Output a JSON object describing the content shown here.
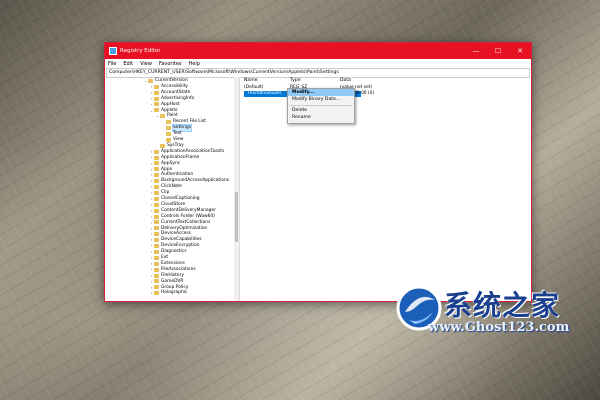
{
  "window": {
    "title": "Registry Editor",
    "controls": {
      "minimize": "—",
      "maximize": "☐",
      "close": "✕"
    }
  },
  "menu": [
    "File",
    "Edit",
    "View",
    "Favorites",
    "Help"
  ],
  "address": "Computer\\HKEY_CURRENT_USER\\Software\\Microsoft\\Windows\\CurrentVersion\\Applets\\Paint\\Settings",
  "tree": [
    {
      "label": "CurrentVersion",
      "depth": 0,
      "exp": "⌄"
    },
    {
      "label": "Accessibility",
      "depth": 1,
      "exp": "›"
    },
    {
      "label": "AccountState",
      "depth": 1,
      "exp": "›"
    },
    {
      "label": "AdvertisingInfo",
      "depth": 1,
      "exp": "›"
    },
    {
      "label": "AppHost",
      "depth": 1,
      "exp": "›"
    },
    {
      "label": "Applets",
      "depth": 1,
      "exp": "⌄"
    },
    {
      "label": "Paint",
      "depth": 2,
      "exp": "⌄"
    },
    {
      "label": "Recent File List",
      "depth": 3,
      "exp": ""
    },
    {
      "label": "Settings",
      "depth": 3,
      "exp": "",
      "selected": true
    },
    {
      "label": "Text",
      "depth": 3,
      "exp": ""
    },
    {
      "label": "View",
      "depth": 3,
      "exp": ""
    },
    {
      "label": "SysTray",
      "depth": 2,
      "exp": ""
    },
    {
      "label": "ApplicationAssociationToasts",
      "depth": 1,
      "exp": "›"
    },
    {
      "label": "ApplicationFrame",
      "depth": 1,
      "exp": "›"
    },
    {
      "label": "AppSync",
      "depth": 1,
      "exp": "›"
    },
    {
      "label": "Appx",
      "depth": 1,
      "exp": "›"
    },
    {
      "label": "Authentication",
      "depth": 1,
      "exp": "›"
    },
    {
      "label": "BackgroundAccessApplications",
      "depth": 1,
      "exp": "›"
    },
    {
      "label": "ClickNote",
      "depth": 1,
      "exp": "›"
    },
    {
      "label": "Clip",
      "depth": 1,
      "exp": "›"
    },
    {
      "label": "ClosedCaptioning",
      "depth": 1,
      "exp": "›"
    },
    {
      "label": "CloudStore",
      "depth": 1,
      "exp": "›"
    },
    {
      "label": "ContentDeliveryManager",
      "depth": 1,
      "exp": "›"
    },
    {
      "label": "Controls Folder (Wow64)",
      "depth": 1,
      "exp": "›"
    },
    {
      "label": "CurrentTextCollections",
      "depth": 1,
      "exp": "›"
    },
    {
      "label": "DeliveryOptimization",
      "depth": 1,
      "exp": "›"
    },
    {
      "label": "DeviceAccess",
      "depth": 1,
      "exp": "›"
    },
    {
      "label": "DeviceCapabilities",
      "depth": 1,
      "exp": "›"
    },
    {
      "label": "DeviceEncryption",
      "depth": 1,
      "exp": "›"
    },
    {
      "label": "Diagnostics",
      "depth": 1,
      "exp": "›"
    },
    {
      "label": "Ext",
      "depth": 1,
      "exp": "›"
    },
    {
      "label": "Extensions",
      "depth": 1,
      "exp": "›"
    },
    {
      "label": "FileAssociations",
      "depth": 1,
      "exp": "›"
    },
    {
      "label": "FileHistory",
      "depth": 1,
      "exp": "›"
    },
    {
      "label": "GameDVR",
      "depth": 1,
      "exp": "›"
    },
    {
      "label": "Group Policy",
      "depth": 1,
      "exp": "›"
    },
    {
      "label": "Holographic",
      "depth": 1,
      "exp": "›"
    }
  ],
  "columns": {
    "name": "Name",
    "type": "Type",
    "data": "Data"
  },
  "values": [
    {
      "name": "(Default)",
      "type": "REG_SZ",
      "data": "(value not set)",
      "selected": false
    },
    {
      "name": "ThumbnailSizes",
      "type": "REG_BINARY",
      "data": "00 00 00 00 (0)",
      "selected": true
    }
  ],
  "context_menu": [
    "Modify...",
    "Modify Binary Data...",
    "Delete",
    "Rename"
  ],
  "watermark": {
    "title": "系统之家",
    "url": "www.Ghost123.com"
  }
}
